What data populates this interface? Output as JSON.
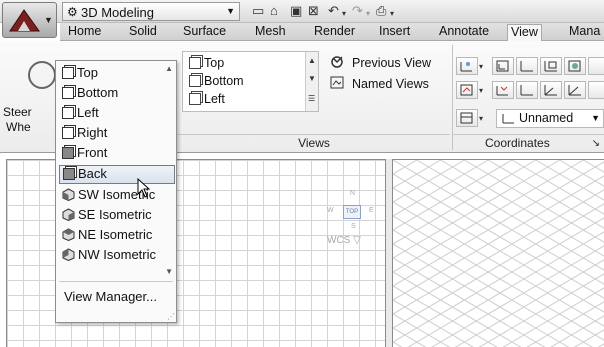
{
  "workspace": {
    "name": "3D Modeling"
  },
  "tabs": [
    {
      "label": "Home"
    },
    {
      "label": "Solid"
    },
    {
      "label": "Surface"
    },
    {
      "label": "Mesh"
    },
    {
      "label": "Render"
    },
    {
      "label": "Insert"
    },
    {
      "label": "Annotate"
    },
    {
      "label": "View",
      "active": true
    },
    {
      "label": "Mana"
    }
  ],
  "ribbon": {
    "steering": {
      "label_line1": "Steer",
      "label_line2": "Whe"
    },
    "views_gallery": {
      "items": [
        {
          "label": "Top"
        },
        {
          "label": "Bottom"
        },
        {
          "label": "Left"
        }
      ]
    },
    "previous_view_label": "Previous View",
    "named_views_label": "Named Views",
    "views_panel_title": "Views",
    "coordinates_panel_title": "Coordinates",
    "ucs_name": "Unnamed"
  },
  "views_dropdown": {
    "items": [
      {
        "label": "Top",
        "icon": "cube-top-icon"
      },
      {
        "label": "Bottom",
        "icon": "cube-bottom-icon"
      },
      {
        "label": "Left",
        "icon": "cube-left-icon"
      },
      {
        "label": "Right",
        "icon": "cube-right-icon"
      },
      {
        "label": "Front",
        "icon": "cube-front-icon"
      },
      {
        "label": "Back",
        "icon": "cube-back-icon",
        "highlighted": true
      },
      {
        "label": "SW Isometric",
        "icon": "iso-sw-icon"
      },
      {
        "label": "SE Isometric",
        "icon": "iso-se-icon"
      },
      {
        "label": "NE Isometric",
        "icon": "iso-ne-icon"
      },
      {
        "label": "NW Isometric",
        "icon": "iso-nw-icon"
      }
    ],
    "manager_label": "View Manager..."
  },
  "viewport": {
    "viewcube_face": "TOP",
    "wcs_label": "WCS"
  },
  "colors": {
    "highlight": "#d9e2ee",
    "viewcube_accent": "#8aa3c8",
    "grid_line": "#d4d4d4"
  }
}
